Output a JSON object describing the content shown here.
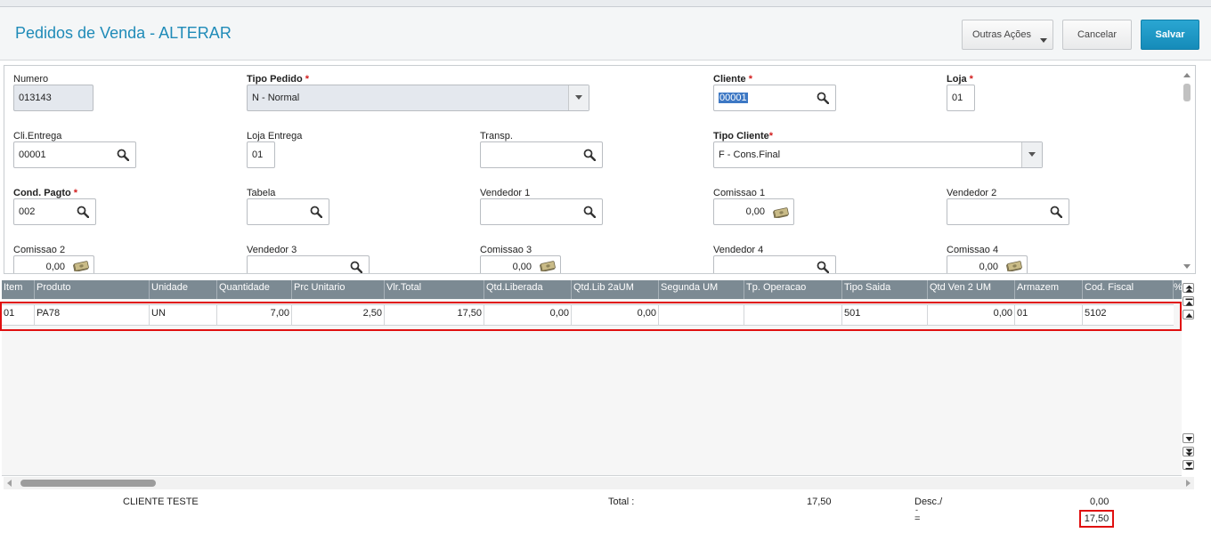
{
  "header": {
    "title": "Pedidos de Venda - ALTERAR",
    "buttons": {
      "outras": "Outras Ações",
      "cancelar": "Cancelar",
      "salvar": "Salvar"
    }
  },
  "form": {
    "numero": {
      "label": "Numero",
      "value": "013143"
    },
    "tipo_pedido": {
      "label": "Tipo Pedido",
      "value": "N - Normal"
    },
    "cliente": {
      "label": "Cliente",
      "value": "00001"
    },
    "loja": {
      "label": "Loja",
      "value": "01"
    },
    "cli_entrega": {
      "label": "Cli.Entrega",
      "value": "00001"
    },
    "loja_entrega": {
      "label": "Loja Entrega",
      "value": "01"
    },
    "transp": {
      "label": "Transp.",
      "value": ""
    },
    "tipo_cliente": {
      "label": "Tipo Cliente",
      "value": "F - Cons.Final"
    },
    "cond_pagto": {
      "label": "Cond. Pagto",
      "value": "002"
    },
    "tabela": {
      "label": "Tabela",
      "value": ""
    },
    "vendedor1": {
      "label": "Vendedor 1",
      "value": ""
    },
    "comissao1": {
      "label": "Comissao 1",
      "value": "0,00"
    },
    "vendedor2": {
      "label": "Vendedor 2",
      "value": ""
    },
    "comissao2": {
      "label": "Comissao 2",
      "value": "0,00"
    },
    "vendedor3": {
      "label": "Vendedor 3",
      "value": ""
    },
    "comissao3": {
      "label": "Comissao 3",
      "value": "0,00"
    },
    "vendedor4": {
      "label": "Vendedor 4",
      "value": ""
    },
    "comissao4": {
      "label": "Comissao 4",
      "value": "0,00"
    }
  },
  "grid": {
    "columns": [
      "Item",
      "Produto",
      "Unidade",
      "Quantidade",
      "Prc Unitario",
      "Vlr.Total",
      "Qtd.Liberada",
      "Qtd.Lib 2aUM",
      "Segunda UM",
      "Tp. Operacao",
      "Tipo Saida",
      "Qtd Ven 2 UM",
      "Armazem",
      "Cod. Fiscal",
      "%"
    ],
    "rows": [
      [
        "01",
        "PA78",
        "UN",
        "7,00",
        "2,50",
        "17,50",
        "0,00",
        "0,00",
        "",
        "",
        "501",
        "0,00",
        "01",
        "5102"
      ]
    ]
  },
  "footer": {
    "client_name": "CLIENTE TESTE",
    "total_label": "Total :",
    "total_value": "17,50",
    "desc_label": "Desc./",
    "desc_dash": "-",
    "eq_label": "=",
    "desc_value": "0,00",
    "final_value": "17,50"
  },
  "icons": {
    "search": "search-icon",
    "money": "money-icon",
    "dropdown": "chevron-down-icon"
  },
  "colors": {
    "accent": "#1f8bb8",
    "primary_button": "#1a94c2",
    "highlight": "#e01010",
    "grid_header": "#7c8a93"
  }
}
